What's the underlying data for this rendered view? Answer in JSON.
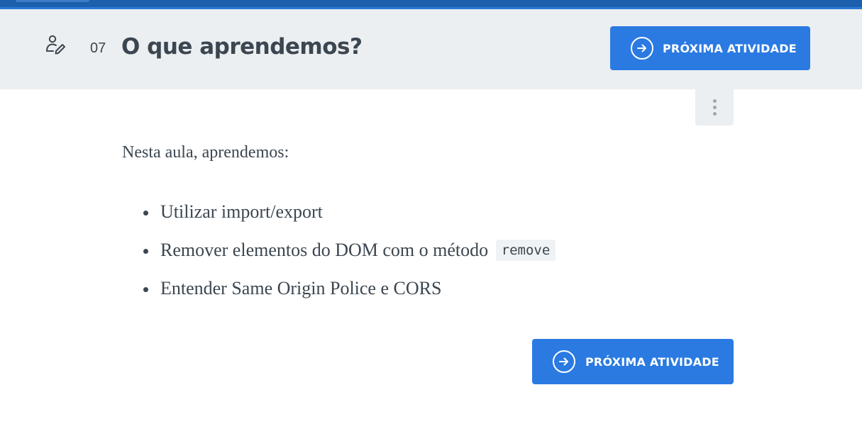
{
  "header": {
    "activity_number": "07",
    "title": "O que aprendemos?",
    "next_button_label": "PRÓXIMA ATIVIDADE",
    "icon": "task-person-pencil-icon"
  },
  "menu": {
    "icon": "more-vertical-icon"
  },
  "content": {
    "intro": "Nesta aula, aprendemos:",
    "bullets": [
      {
        "text": "Utilizar import/export"
      },
      {
        "text": "Remover elementos do DOM com o método",
        "code": "remove"
      },
      {
        "text": "Entender Same Origin Police e CORS"
      }
    ]
  },
  "footer": {
    "next_button_label": "PRÓXIMA ATIVIDADE",
    "icon": "arrow-right-circle-icon"
  },
  "colors": {
    "accent": "#2a7ae2",
    "header_bg": "#ebeff1",
    "topbar": "#1c5fad",
    "text": "#3b4650"
  }
}
